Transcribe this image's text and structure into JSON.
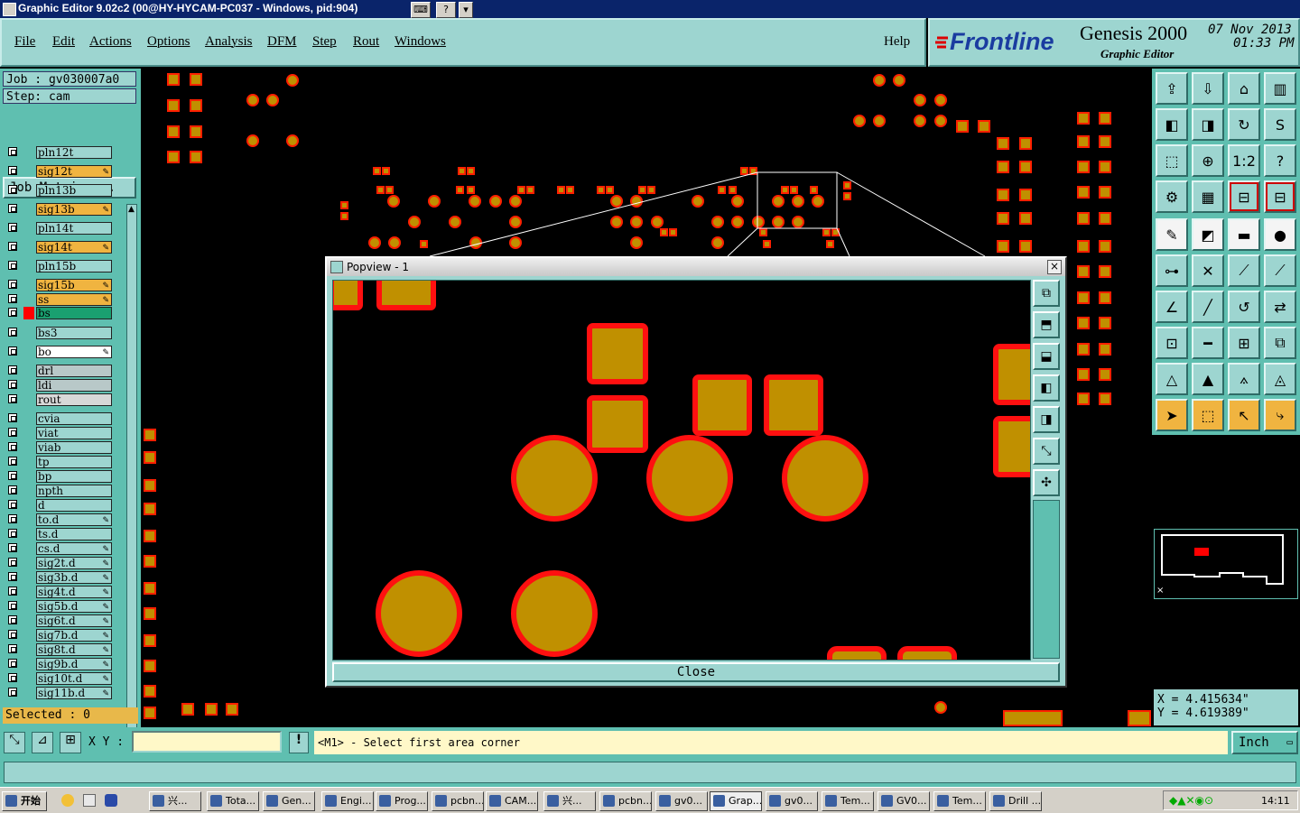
{
  "window": {
    "title": "Graphic Editor 9.02c2 (00@HY-HYCAM-PC037 - Windows, pid:904)"
  },
  "menu": [
    "File",
    "Edit",
    "Actions",
    "Options",
    "Analysis",
    "DFM",
    "Step",
    "Rout",
    "Windows"
  ],
  "help_label": "Help",
  "brand": {
    "logo": "Frontline",
    "product": "Genesis 2000",
    "subtitle": "Graphic Editor",
    "date": "07 Nov 2013",
    "time": "01:33 PM"
  },
  "job": {
    "job_label": "Job : gv030007a0",
    "step_label": "Step: cam",
    "matrix_button": "Job Matrix ..."
  },
  "layers": [
    {
      "name": "pln12t",
      "color": "#9dd5d0",
      "editable": false
    },
    {
      "name": "sig12t",
      "color": "#f0b440",
      "editable": true
    },
    {
      "name": "pln13b",
      "color": "#9dd5d0",
      "editable": false
    },
    {
      "name": "sig13b",
      "color": "#f0b440",
      "editable": true
    },
    {
      "name": "pln14t",
      "color": "#9dd5d0",
      "editable": false
    },
    {
      "name": "sig14t",
      "color": "#f0b440",
      "editable": true
    },
    {
      "name": "pln15b",
      "color": "#9dd5d0",
      "editable": false
    },
    {
      "name": "sig15b",
      "color": "#f0b440",
      "editable": true
    },
    {
      "name": "ss",
      "color": "#f0b440",
      "editable": true
    },
    {
      "name": "bs",
      "color": "#1aa070",
      "editable": false,
      "active": true
    },
    {
      "name": "bs3",
      "color": "#9dd5d0",
      "editable": false
    },
    {
      "name": "bo",
      "color": "#ffffff",
      "editable": true
    },
    {
      "name": "drl",
      "color": "#b8c8c8",
      "editable": false
    },
    {
      "name": "ldi",
      "color": "#b8c8c8",
      "editable": false
    },
    {
      "name": "rout",
      "color": "#d8d8d8",
      "editable": false
    },
    {
      "name": "cvia",
      "color": "#9dd5d0",
      "editable": false
    },
    {
      "name": "viat",
      "color": "#9dd5d0",
      "editable": false
    },
    {
      "name": "viab",
      "color": "#9dd5d0",
      "editable": false
    },
    {
      "name": "tp",
      "color": "#9dd5d0",
      "editable": false
    },
    {
      "name": "bp",
      "color": "#9dd5d0",
      "editable": false
    },
    {
      "name": "npth",
      "color": "#9dd5d0",
      "editable": false
    },
    {
      "name": "d",
      "color": "#9dd5d0",
      "editable": false
    },
    {
      "name": "to.d",
      "color": "#9dd5d0",
      "editable": true
    },
    {
      "name": "ts.d",
      "color": "#9dd5d0",
      "editable": false
    },
    {
      "name": "cs.d",
      "color": "#9dd5d0",
      "editable": true
    },
    {
      "name": "sig2t.d",
      "color": "#9dd5d0",
      "editable": true
    },
    {
      "name": "sig3b.d",
      "color": "#9dd5d0",
      "editable": true
    },
    {
      "name": "sig4t.d",
      "color": "#9dd5d0",
      "editable": true
    },
    {
      "name": "sig5b.d",
      "color": "#9dd5d0",
      "editable": true
    },
    {
      "name": "sig6t.d",
      "color": "#9dd5d0",
      "editable": true
    },
    {
      "name": "sig7b.d",
      "color": "#9dd5d0",
      "editable": true
    },
    {
      "name": "sig8t.d",
      "color": "#9dd5d0",
      "editable": true
    },
    {
      "name": "sig9b.d",
      "color": "#9dd5d0",
      "editable": true
    },
    {
      "name": "sig10t.d",
      "color": "#9dd5d0",
      "editable": true
    },
    {
      "name": "sig11b.d",
      "color": "#9dd5d0",
      "editable": true
    }
  ],
  "selected_label": "Selected : 0",
  "popview": {
    "title": "Popview - 1",
    "close_label": "Close"
  },
  "coords": {
    "x": "X = 4.415634\"",
    "y": "Y = 4.619389\""
  },
  "command": {
    "xy_label": "X Y :",
    "xy_value": "",
    "prompt": "<M1> - Select first area corner",
    "units": "Inch"
  },
  "taskbar": {
    "start": "开始",
    "items": [
      "兴...",
      "Tota...",
      "Gen...",
      "Engi...",
      "Prog...",
      "pcbn...",
      "CAM...",
      "兴...",
      "pcbn...",
      "gv0...",
      "Grap...",
      "gv0...",
      "Tem...",
      "GV0...",
      "Tem...",
      "Drill ..."
    ],
    "clock": "14:11"
  },
  "colors": {
    "panel": "#9dd5d0",
    "pad_fill": "#c09000",
    "pad_outline": "#ff0000",
    "accent_orange": "#f0b440"
  }
}
